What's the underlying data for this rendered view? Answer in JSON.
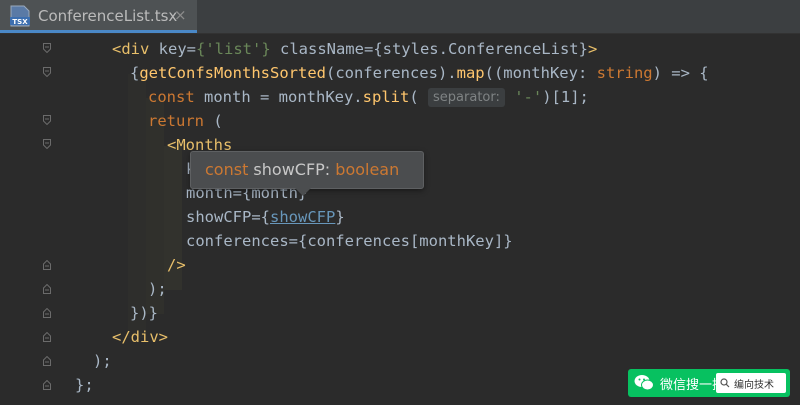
{
  "tab": {
    "icon_text": "TSX",
    "filename": "ConferenceList.tsx",
    "close_glyph": "×"
  },
  "code": {
    "l1": {
      "open": "<div",
      "key_attr": " key=",
      "key_val": "{'list'}",
      "class_attr": " className=",
      "class_val": "{styles.ConferenceList}",
      "close": ">"
    },
    "l2": {
      "brace": "{",
      "fn": "getConfsMonthsSorted",
      "args": "(conferences).",
      "map": "map",
      "cb": "((monthKey: ",
      "type": "string",
      "rest": ") => {"
    },
    "l3": {
      "kw": "const",
      "mid": " month = monthKey.",
      "fn": "split",
      "paren": "(",
      "hint": "separator:",
      "str": "'-'",
      "rest": ")[1];"
    },
    "l4": {
      "kw": "return",
      "rest": " ("
    },
    "l5": {
      "tag": "<Months"
    },
    "l6": {
      "text": "k"
    },
    "l7": {
      "text": "month={month}"
    },
    "l8": {
      "attr": "showCFP={",
      "link": "showCFP",
      "end": "}"
    },
    "l9": {
      "text": "conferences={conferences[monthKey]}"
    },
    "l10": {
      "tag": "/>"
    },
    "l11": {
      "text": ");"
    },
    "l12": {
      "text": "})}"
    },
    "l13": {
      "tag": "</div>"
    },
    "l14": {
      "text": ");"
    },
    "l15": {
      "text": "};"
    }
  },
  "tooltip": {
    "kw": "const",
    "name": " showCFP: ",
    "type": "boolean"
  },
  "watermark": {
    "label": "微信搜一搜",
    "search_text": "编向技术"
  },
  "colors": {
    "background": "#2b2b2b",
    "keyword": "#cc7832",
    "string": "#6a8759",
    "tag": "#e8bf6a",
    "function": "#ffc66d",
    "link": "#6897bb",
    "watermark": "#07c160"
  }
}
